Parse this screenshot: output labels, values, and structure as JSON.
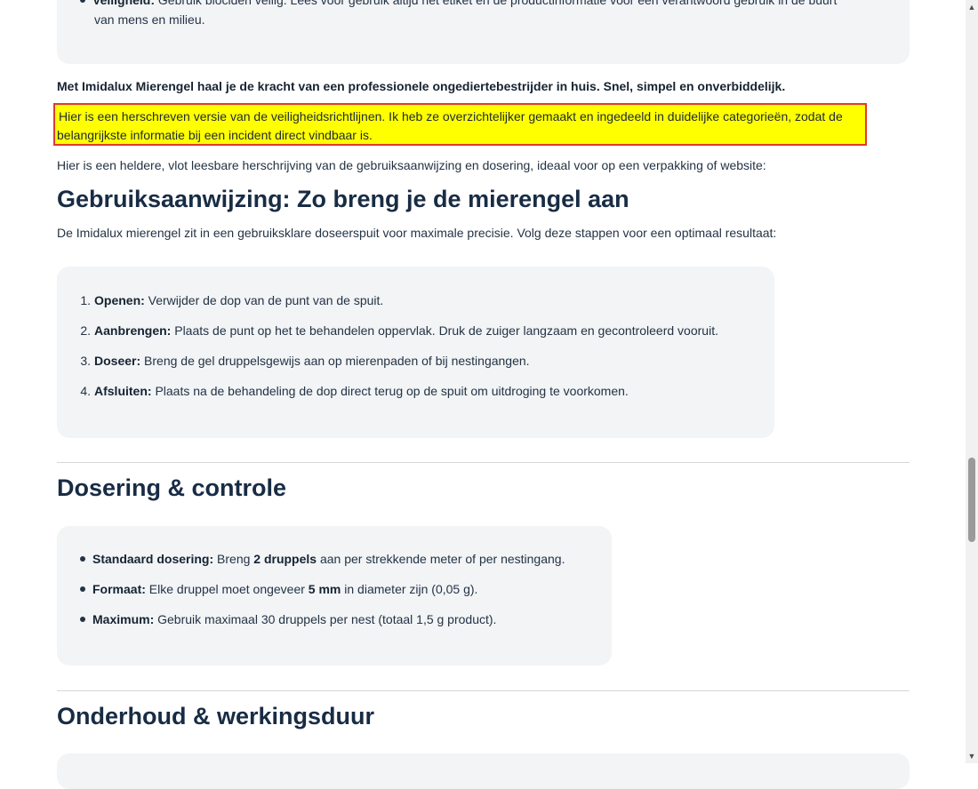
{
  "top_card": {
    "item_label": "Veiligheid:",
    "item_text_line1": "Gebruik biociden veilig. Lees voor gebruik altijd het etiket en de productinformatie voor een verantwoord gebruik in de buurt",
    "item_text_line2": "van mens en milieu."
  },
  "intro_bold": "Met Imidalux Mierengel haal je de kracht van een professionele ongediertebestrijder in huis. Snel, simpel en onverbiddelijk.",
  "highlighted": {
    "line1": "Hier is een herschreven versie van de veiligheidsrichtlijnen. Ik heb ze overzichtelijker gemaakt en ingedeeld in duidelijke categorieën, zodat de",
    "line2": "belangrijkste informatie bij een incident direct vindbaar is."
  },
  "intro_text": "Hier is een heldere, vlot leesbare herschrijving van de gebruiksaanwijzing en dosering, ideaal voor op een verpakking of website:",
  "section1": {
    "heading": "Gebruiksaanwijzing: Zo breng  je de mierengel aan",
    "intro": "De Imidalux mierengel zit in een gebruiksklare doseerspuit voor maximale precisie. Volg deze stappen voor een optimaal resultaat:",
    "steps": [
      {
        "num": "1.",
        "label": "Openen:",
        "text": " Verwijder de dop van de punt van de spuit."
      },
      {
        "num": "2.",
        "label": "Aanbrengen:",
        "text": " Plaats de punt op het te behandelen oppervlak. Druk de zuiger langzaam en gecontroleerd vooruit."
      },
      {
        "num": "3.",
        "label": "Doseer:",
        "text": " Breng de gel druppelsgewijs aan op mierenpaden of bij nestingangen."
      },
      {
        "num": "4.",
        "label": "Afsluiten:",
        "text": " Plaats na de behandeling de dop direct terug op de spuit om uitdroging te voorkomen."
      }
    ]
  },
  "section2": {
    "heading": "Dosering & controle",
    "items": [
      {
        "label": "Standaard dosering:",
        "pre": " Breng ",
        "strong": "2 druppels",
        "post": " aan per strekkende meter of per nestingang."
      },
      {
        "label": "Formaat:",
        "pre": " Elke druppel moet ongeveer ",
        "strong": "5 mm",
        "post": " in diameter zijn (0,05 g)."
      },
      {
        "label": "Maximum:",
        "pre": " Gebruik maximaal 30 druppels per nest (totaal 1,5 g product).",
        "strong": "",
        "post": ""
      }
    ]
  },
  "section3": {
    "heading": "Onderhoud & werkingsduur"
  },
  "scrollbar": {
    "up_glyph": "▲",
    "down_glyph": "▼"
  }
}
